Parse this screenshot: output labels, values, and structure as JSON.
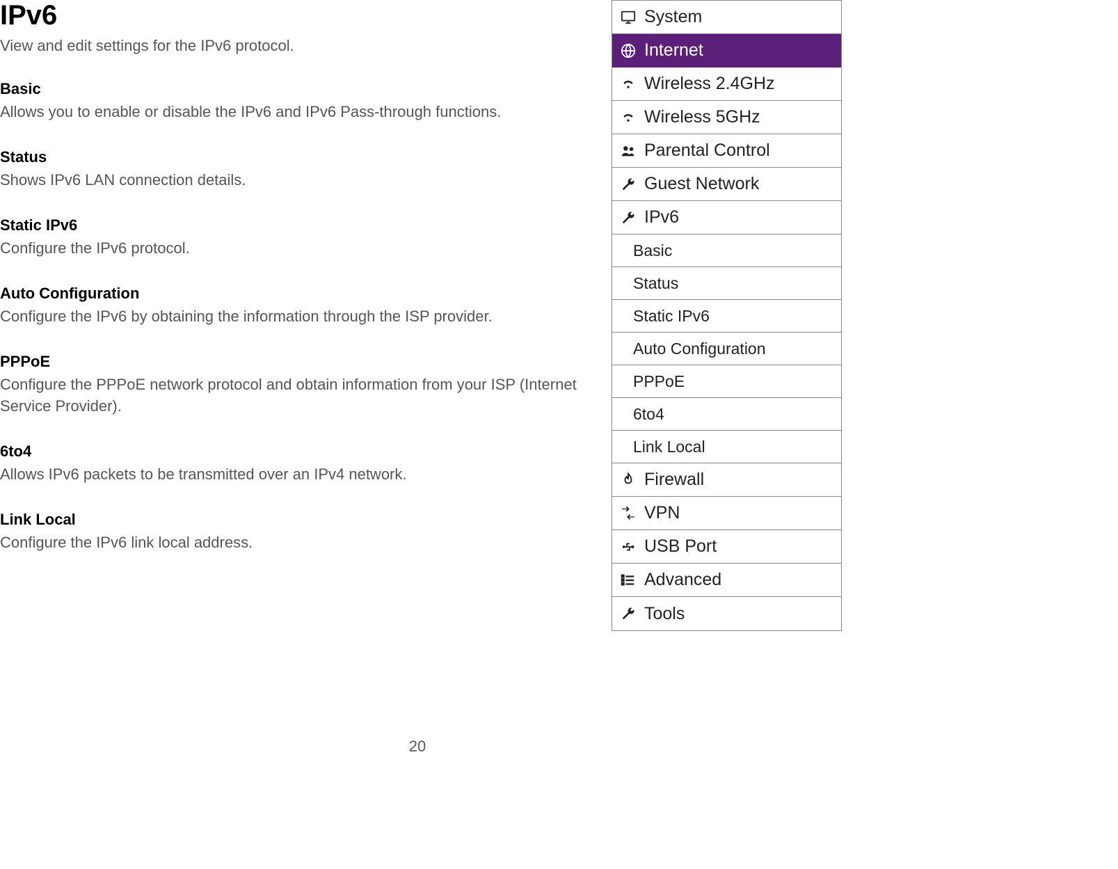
{
  "page": {
    "title": "IPv6",
    "subtitle": "View and edit settings for the IPv6 protocol.",
    "number": "20"
  },
  "sections": [
    {
      "title": "Basic",
      "desc": "Allows you to enable or disable the IPv6 and IPv6 Pass-through functions."
    },
    {
      "title": "Status",
      "desc": "Shows IPv6 LAN connection details."
    },
    {
      "title": "Static IPv6",
      "desc": "Configure the IPv6 protocol."
    },
    {
      "title": "Auto Configuration",
      "desc": "Configure the IPv6 by obtaining the information through the ISP provider."
    },
    {
      "title": "PPPoE",
      "desc": "Configure the PPPoE network protocol and obtain information from your ISP (Internet Service Provider)."
    },
    {
      "title": "6to4",
      "desc": "Allows IPv6 packets to be transmitted over an IPv4 network."
    },
    {
      "title": "Link Local",
      "desc": "Configure the IPv6 link local address."
    }
  ],
  "nav": {
    "items": [
      {
        "label": "System",
        "icon": "monitor"
      },
      {
        "label": "Internet",
        "icon": "globe",
        "active": true
      },
      {
        "label": "Wireless 2.4GHz",
        "icon": "wifi"
      },
      {
        "label": "Wireless 5GHz",
        "icon": "wifi"
      },
      {
        "label": "Parental Control",
        "icon": "users"
      },
      {
        "label": "Guest Network",
        "icon": "wrench"
      },
      {
        "label": "IPv6",
        "icon": "wrench",
        "expanded": true,
        "subs": [
          "Basic",
          "Status",
          "Static IPv6",
          "Auto Configuration",
          "PPPoE",
          "6to4",
          "Link Local"
        ]
      },
      {
        "label": "Firewall",
        "icon": "fire"
      },
      {
        "label": "VPN",
        "icon": "arrows"
      },
      {
        "label": "USB Port",
        "icon": "usb"
      },
      {
        "label": "Advanced",
        "icon": "list"
      },
      {
        "label": "Tools",
        "icon": "wrench"
      }
    ]
  }
}
